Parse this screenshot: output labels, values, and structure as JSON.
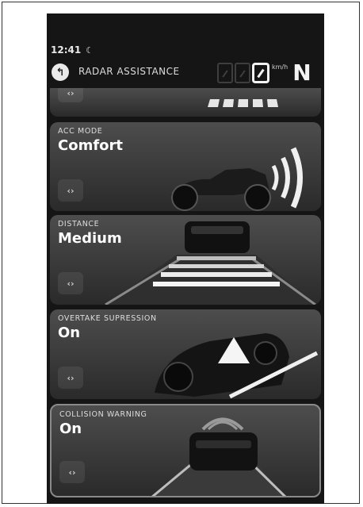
{
  "status": {
    "time": "12:41",
    "night_icon": "moon-icon",
    "night_glyph": "☾"
  },
  "header": {
    "back_glyph": "↰",
    "title": "RADAR ASSISTANCE",
    "speed_value": "0",
    "speed_unit": "km/h",
    "gear": "N"
  },
  "cards": [
    {
      "label": "",
      "value": ""
    },
    {
      "label": "ACC MODE",
      "value": "Comfort"
    },
    {
      "label": "DISTANCE",
      "value": "Medium"
    },
    {
      "label": "OVERTAKE SUPRESSION",
      "value": "On"
    },
    {
      "label": "COLLISION WARNING",
      "value": "On"
    }
  ],
  "toggle_glyph": "‹›",
  "alert_glyph": "!"
}
